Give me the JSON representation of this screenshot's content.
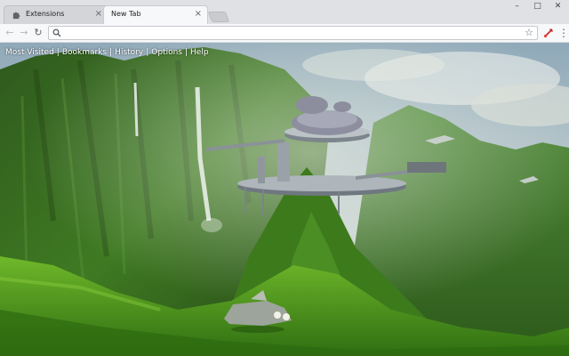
{
  "tabs": [
    {
      "title": "Extensions",
      "icon": "puzzle-icon",
      "close": "×",
      "active": false
    },
    {
      "title": "New Tab",
      "close": "×",
      "active": true
    }
  ],
  "window_controls": {
    "minimize": "–",
    "maximize": "□",
    "close": "✕"
  },
  "toolbar": {
    "back": "←",
    "forward": "→",
    "reload": "↻",
    "omnibox_value": "",
    "bookmark_star": "☆",
    "menu": "⋮"
  },
  "new_tab_page": {
    "links": [
      "Most Visited",
      "Bookmarks",
      "History",
      "Options",
      "Help"
    ],
    "separator": "|"
  }
}
